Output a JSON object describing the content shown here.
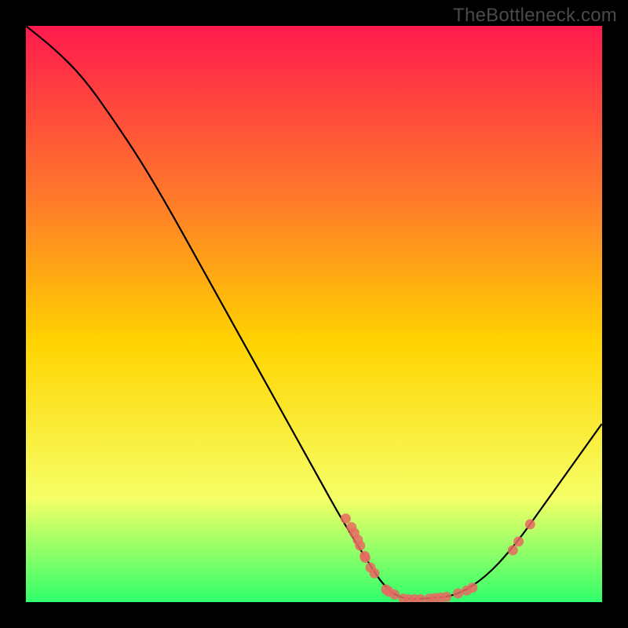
{
  "watermark": "TheBottleneck.com",
  "colors": {
    "background": "#000000",
    "gradient_top": "#ff1a4d",
    "gradient_mid_upper": "#ff7a2a",
    "gradient_mid": "#ffd400",
    "gradient_lower": "#f6ff66",
    "gradient_bottom": "#2fff6b",
    "curve": "#000000",
    "dot_fill": "#e86a62",
    "dot_stroke": "#e86a62"
  },
  "chart_data": {
    "type": "line",
    "title": "",
    "xlabel": "",
    "ylabel": "",
    "xlim": [
      0,
      100
    ],
    "ylim": [
      0,
      100
    ],
    "curve": {
      "x": [
        0,
        5,
        10,
        15,
        20,
        25,
        30,
        35,
        40,
        45,
        50,
        55,
        60,
        62,
        65,
        70,
        75,
        80,
        85,
        90,
        95,
        100
      ],
      "y": [
        100,
        96,
        91,
        84,
        76.5,
        68,
        59,
        50,
        41,
        32,
        23,
        14,
        6,
        3,
        0.5,
        0.6,
        1.2,
        4.5,
        10,
        17,
        24,
        31
      ]
    },
    "dots": [
      {
        "x": 55.5,
        "y": 14.5
      },
      {
        "x": 56.5,
        "y": 13.0
      },
      {
        "x": 57.0,
        "y": 12.0
      },
      {
        "x": 57.6,
        "y": 10.8
      },
      {
        "x": 58.0,
        "y": 9.8
      },
      {
        "x": 58.8,
        "y": 8.0
      },
      {
        "x": 58.9,
        "y": 7.7
      },
      {
        "x": 59.8,
        "y": 6.0
      },
      {
        "x": 60.5,
        "y": 5.0
      },
      {
        "x": 62.5,
        "y": 2.2
      },
      {
        "x": 63.0,
        "y": 1.8
      },
      {
        "x": 64.0,
        "y": 1.3
      },
      {
        "x": 65.5,
        "y": 0.6
      },
      {
        "x": 66.5,
        "y": 0.5
      },
      {
        "x": 67.5,
        "y": 0.5
      },
      {
        "x": 68.5,
        "y": 0.5
      },
      {
        "x": 70.0,
        "y": 0.6
      },
      {
        "x": 71.0,
        "y": 0.7
      },
      {
        "x": 72.0,
        "y": 0.8
      },
      {
        "x": 73.0,
        "y": 0.9
      },
      {
        "x": 75.0,
        "y": 1.5
      },
      {
        "x": 76.5,
        "y": 2.0
      },
      {
        "x": 77.5,
        "y": 2.5
      },
      {
        "x": 84.5,
        "y": 9.0
      },
      {
        "x": 85.5,
        "y": 10.5
      },
      {
        "x": 87.5,
        "y": 13.5
      }
    ]
  }
}
